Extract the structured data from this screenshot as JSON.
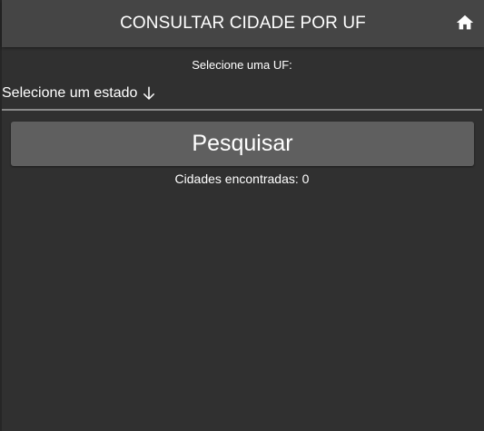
{
  "header": {
    "title": "CONSULTAR CIDADE POR UF",
    "home_icon": "home-icon"
  },
  "form": {
    "uf_label": "Selecione uma UF:",
    "select_value": "Selecione um estado",
    "select_arrow_icon": "arrow-down-icon",
    "search_button_label": "Pesquisar"
  },
  "results": {
    "count_label": "Cidades encontradas:",
    "count_value": "0"
  },
  "colors": {
    "background": "#303030",
    "header": "#454545",
    "button": "#5f5f5f",
    "underline": "#8a8a8a",
    "text": "#ffffff"
  }
}
